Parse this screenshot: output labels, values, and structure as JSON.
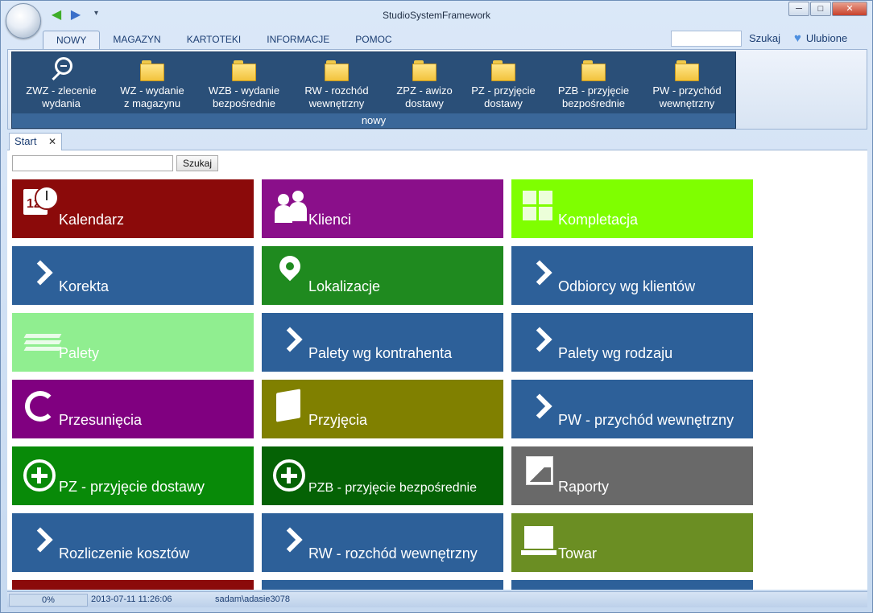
{
  "window": {
    "title": "StudioSystemFramework",
    "controls": {
      "minimize": "─",
      "maximize": "□",
      "close": "✕"
    }
  },
  "quick_access": {
    "back_icon": "back-arrow-icon",
    "forward_icon": "forward-arrow-icon",
    "dropdown": "▾"
  },
  "ribbon": {
    "tabs": [
      {
        "label": "NOWY",
        "active": true
      },
      {
        "label": "MAGAZYN",
        "active": false
      },
      {
        "label": "KARTOTEKI",
        "active": false
      },
      {
        "label": "INFORMACJE",
        "active": false
      },
      {
        "label": "POMOC",
        "active": false
      }
    ],
    "search": {
      "value": "",
      "label": "Szukaj"
    },
    "favorites": {
      "label": "Ulubione",
      "icon": "heart-icon"
    },
    "group": {
      "label": "nowy",
      "buttons": [
        {
          "line1": "ZWZ - zlecenie",
          "line2": "wydania",
          "icon": "magnifier-icon"
        },
        {
          "line1": "WZ - wydanie",
          "line2": "z magazynu",
          "icon": "folder-icon"
        },
        {
          "line1": "WZB - wydanie",
          "line2": "bezpośrednie",
          "icon": "folder-icon"
        },
        {
          "line1": "RW - rozchód",
          "line2": "wewnętrzny",
          "icon": "folder-icon"
        },
        {
          "line1": "ZPZ - awizo",
          "line2": "dostawy",
          "icon": "folder-icon"
        },
        {
          "line1": "PZ - przyjęcie",
          "line2": "dostawy",
          "icon": "folder-icon"
        },
        {
          "line1": "PZB - przyjęcie",
          "line2": "bezpośrednie",
          "icon": "folder-icon"
        },
        {
          "line1": "PW - przychód",
          "line2": "wewnętrzny",
          "icon": "folder-icon"
        }
      ]
    }
  },
  "document_tab": {
    "label": "Start",
    "close": "✕"
  },
  "content": {
    "search": {
      "value": "",
      "button": "Szukaj"
    },
    "tiles": [
      {
        "label": "Kalendarz",
        "color": "#8b0a0a",
        "icon": "calendar-clock-icon"
      },
      {
        "label": "Klienci",
        "color": "#8a0f8a",
        "icon": "people-icon"
      },
      {
        "label": "Kompletacja",
        "color": "#7fff00",
        "icon": "cube-icon"
      },
      {
        "label": "Korekta",
        "color": "#2d6099",
        "icon": "chevron-right-icon"
      },
      {
        "label": "Lokalizacje",
        "color": "#1f8a1f",
        "icon": "map-pin-icon"
      },
      {
        "label": "Odbiorcy wg klientów",
        "color": "#2d6099",
        "icon": "chevron-right-icon"
      },
      {
        "label": "Palety",
        "color": "#90ee90",
        "icon": "pallet-icon"
      },
      {
        "label": "Palety wg kontrahenta",
        "color": "#2d6099",
        "icon": "chevron-right-icon"
      },
      {
        "label": "Palety wg rodzaju",
        "color": "#2d6099",
        "icon": "chevron-right-icon"
      },
      {
        "label": "Przesunięcia",
        "color": "#800080",
        "icon": "refresh-icon"
      },
      {
        "label": "Przyjęcia",
        "color": "#808000",
        "icon": "box-icon"
      },
      {
        "label": "PW - przychód wewnętrzny",
        "color": "#2d6099",
        "icon": "chevron-right-icon"
      },
      {
        "label": "PZ - przyjęcie dostawy",
        "color": "#088a08",
        "icon": "plus-circle-icon"
      },
      {
        "label": "PZB - przyjęcie bezpośrednie",
        "color": "#056205",
        "icon": "plus-circle-icon"
      },
      {
        "label": "Raporty",
        "color": "#696969",
        "icon": "chart-icon"
      },
      {
        "label": "Rozliczenie kosztów",
        "color": "#2d6099",
        "icon": "chevron-right-icon"
      },
      {
        "label": "RW - rozchód wewnętrzny",
        "color": "#2d6099",
        "icon": "chevron-right-icon"
      },
      {
        "label": "Towar",
        "color": "#6b8e23",
        "icon": "cart-icon"
      },
      {
        "label": "",
        "color": "#8b0a0a",
        "icon": ""
      },
      {
        "label": "",
        "color": "#2d6099",
        "icon": ""
      },
      {
        "label": "",
        "color": "#2d6099",
        "icon": ""
      }
    ]
  },
  "status": {
    "progress_value": 0,
    "progress_text": "0%",
    "datetime": "2013-07-11 11:26:06",
    "user": "sadam\\adasie3078"
  }
}
